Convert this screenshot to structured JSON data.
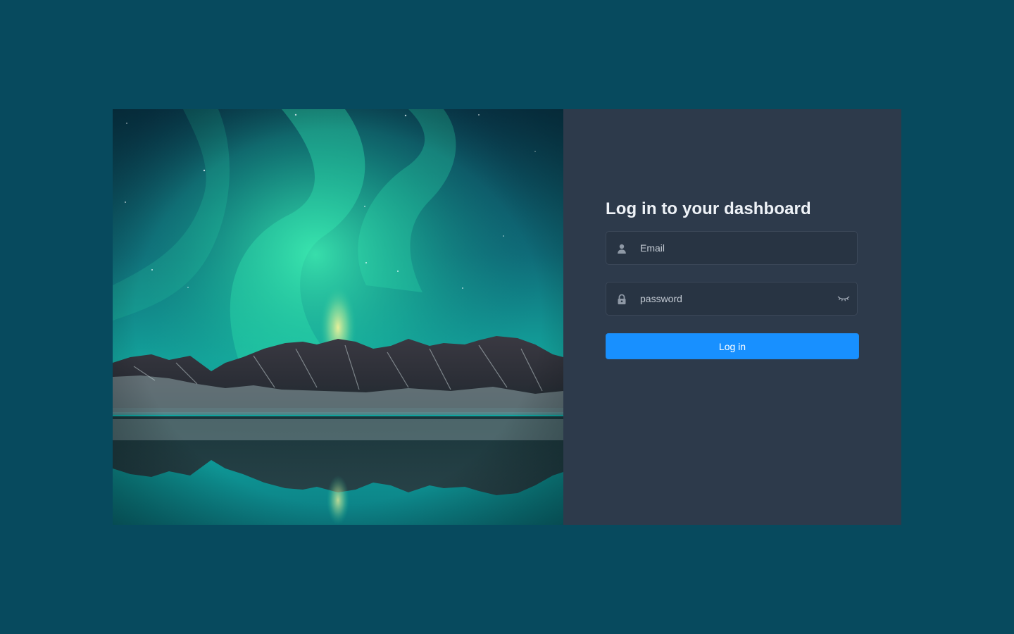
{
  "login": {
    "title": "Log in to your dashboard",
    "email_placeholder": "Email",
    "password_placeholder": "password",
    "submit_label": "Log in"
  },
  "icons": {
    "email": "user-icon",
    "password": "lock-icon",
    "toggle": "eye-closed-icon"
  },
  "colors": {
    "page_background": "#074a5e",
    "panel_background": "#2d3a4b",
    "input_background": "#283443",
    "button": "#1890ff"
  }
}
